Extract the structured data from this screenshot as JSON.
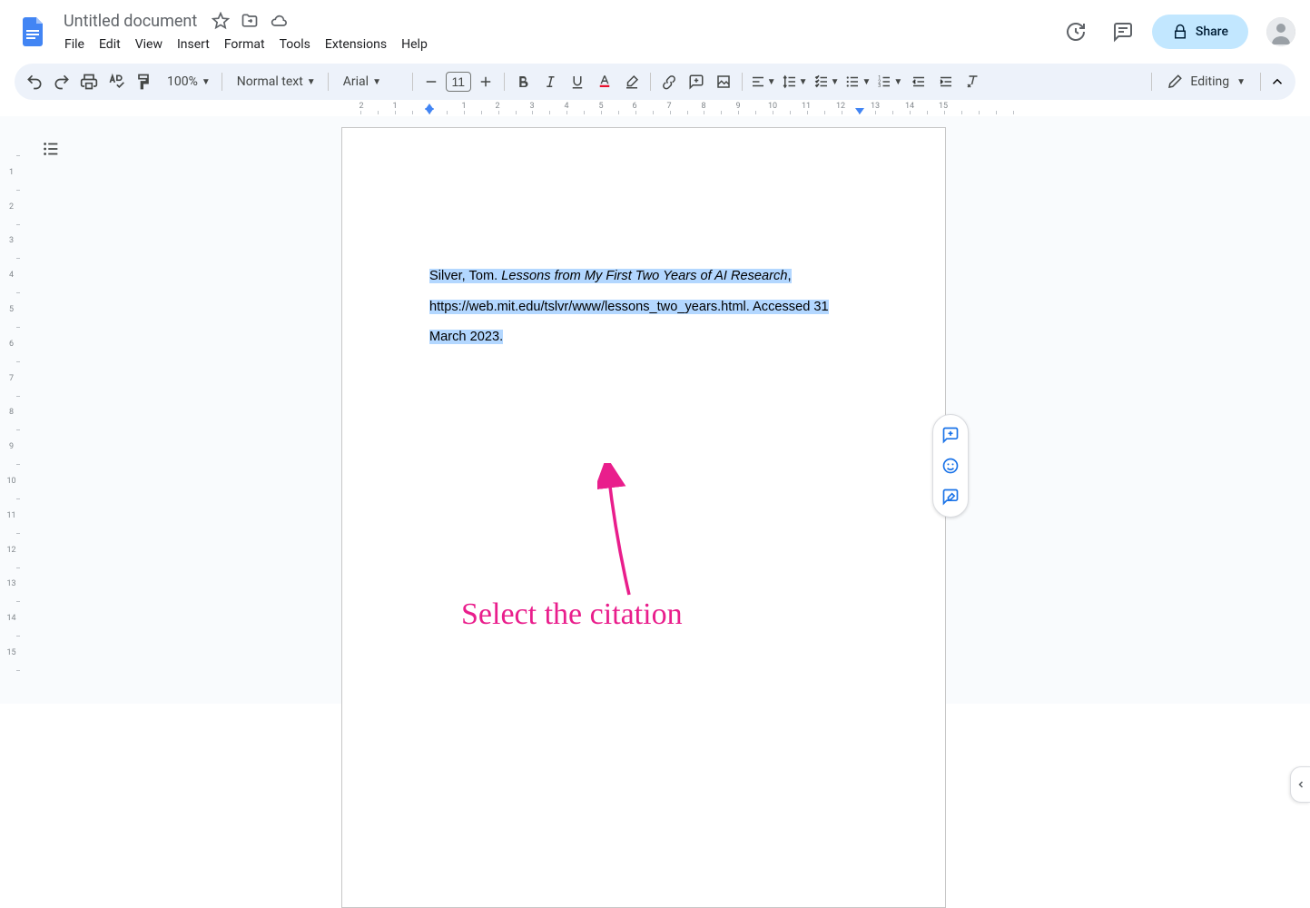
{
  "header": {
    "title": "Untitled document",
    "menus": [
      "File",
      "Edit",
      "View",
      "Insert",
      "Format",
      "Tools",
      "Extensions",
      "Help"
    ],
    "share_label": "Share"
  },
  "toolbar": {
    "zoom": "100%",
    "style": "Normal text",
    "font": "Arial",
    "font_size": "11",
    "mode": "Editing"
  },
  "document": {
    "citation_author": "Silver, Tom. ",
    "citation_title": "Lessons from My First Two Years of AI Research",
    "citation_rest": ", https://web.mit.edu/tslvr/www/lessons_two_years.html. Accessed 31 March 2023."
  },
  "annotation": {
    "label": "Select the citation"
  },
  "ruler": {
    "h_marks": [
      {
        "pos": -75,
        "label": "2"
      },
      {
        "pos": -38,
        "label": "1"
      },
      {
        "pos": 38,
        "label": "1"
      },
      {
        "pos": 75,
        "label": "2"
      },
      {
        "pos": 113,
        "label": "3"
      },
      {
        "pos": 151,
        "label": "4"
      },
      {
        "pos": 189,
        "label": "5"
      },
      {
        "pos": 226,
        "label": "6"
      },
      {
        "pos": 264,
        "label": "7"
      },
      {
        "pos": 302,
        "label": "8"
      },
      {
        "pos": 340,
        "label": "9"
      },
      {
        "pos": 378,
        "label": "10"
      },
      {
        "pos": 415,
        "label": "11"
      },
      {
        "pos": 453,
        "label": "12"
      },
      {
        "pos": 491,
        "label": "13"
      },
      {
        "pos": 529,
        "label": "14"
      },
      {
        "pos": 566,
        "label": "15"
      }
    ],
    "v_marks": [
      "",
      "1",
      "2",
      "3",
      "4",
      "5",
      "6",
      "7",
      "8",
      "9",
      "10",
      "11",
      "12",
      "13",
      "14",
      "15"
    ]
  }
}
